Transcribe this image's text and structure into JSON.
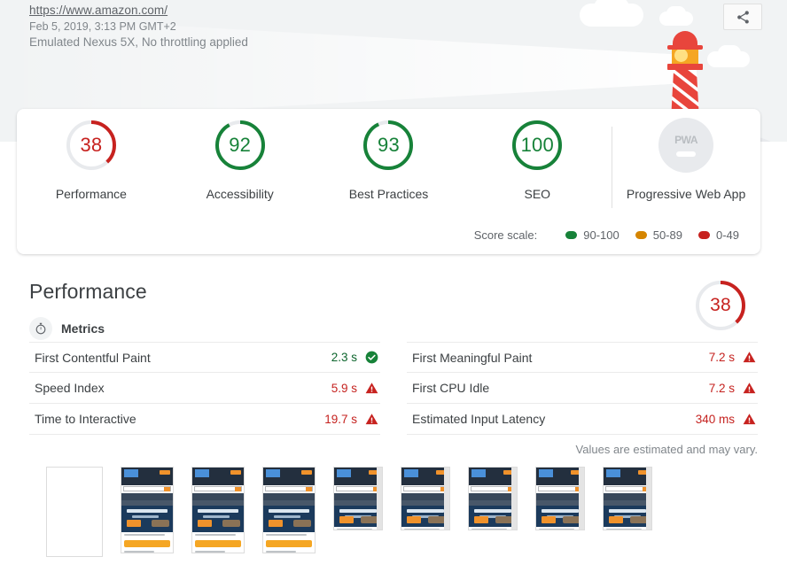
{
  "header": {
    "url": "https://www.amazon.com/",
    "timestamp": "Feb 5, 2019, 3:13 PM GMT+2",
    "environment": "Emulated Nexus 5X, No throttling applied",
    "share_icon": "share-icon",
    "illustration": "lighthouse-illustration"
  },
  "scores": {
    "gauges": [
      {
        "label": "Performance",
        "value": "38",
        "percent": 38,
        "color": "#c7221f",
        "status": "fail"
      },
      {
        "label": "Accessibility",
        "value": "92",
        "percent": 92,
        "color": "#178239",
        "status": "pass"
      },
      {
        "label": "Best Practices",
        "value": "93",
        "percent": 93,
        "color": "#178239",
        "status": "pass"
      },
      {
        "label": "SEO",
        "value": "100",
        "percent": 100,
        "color": "#178239",
        "status": "pass"
      }
    ],
    "pwa": {
      "label": "Progressive Web App",
      "badge_text": "PWA"
    },
    "scale": {
      "title": "Score scale:",
      "items": [
        {
          "range": "90-100",
          "color": "#178239"
        },
        {
          "range": "50-89",
          "color": "#d58500"
        },
        {
          "range": "0-49",
          "color": "#c7221f"
        }
      ]
    }
  },
  "performance": {
    "title": "Performance",
    "score": "38",
    "score_percent": 38,
    "score_color": "#c7221f",
    "metrics_header": {
      "label": "Metrics",
      "icon": "stopwatch-icon"
    },
    "left_metrics": [
      {
        "name": "First Contentful Paint",
        "value": "2.3 s",
        "status": "pass"
      },
      {
        "name": "Speed Index",
        "value": "5.9 s",
        "status": "fail"
      },
      {
        "name": "Time to Interactive",
        "value": "19.7 s",
        "status": "fail"
      }
    ],
    "right_metrics": [
      {
        "name": "First Meaningful Paint",
        "value": "7.2 s",
        "status": "fail"
      },
      {
        "name": "First CPU Idle",
        "value": "7.2 s",
        "status": "fail"
      },
      {
        "name": "Estimated Input Latency",
        "value": "340 ms",
        "status": "fail"
      }
    ],
    "note": "Values are estimated and may vary."
  },
  "filmstrip": {
    "frames": [
      {
        "kind": "blank"
      },
      {
        "kind": "tall"
      },
      {
        "kind": "tall"
      },
      {
        "kind": "tall"
      },
      {
        "kind": "short"
      },
      {
        "kind": "short"
      },
      {
        "kind": "short"
      },
      {
        "kind": "short"
      },
      {
        "kind": "short"
      }
    ]
  }
}
